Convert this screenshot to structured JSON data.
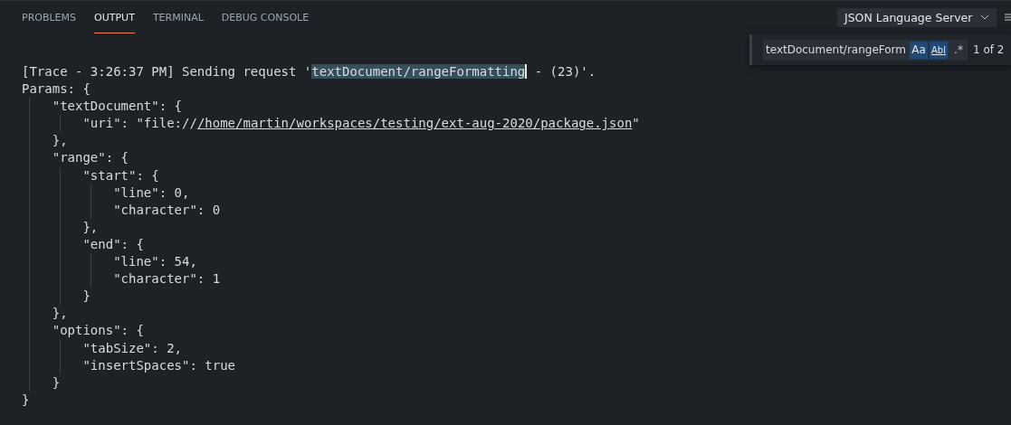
{
  "tabs": [
    {
      "label": "PROBLEMS",
      "selected": false
    },
    {
      "label": "OUTPUT",
      "selected": true
    },
    {
      "label": "TERMINAL",
      "selected": false
    },
    {
      "label": "DEBUG CONSOLE",
      "selected": false
    }
  ],
  "channel_select": {
    "value": "JSON Language Server"
  },
  "find_widget": {
    "value": "textDocument/rangeForm",
    "match_case": {
      "label": "Aa",
      "on": true
    },
    "whole_word": {
      "label": "Abl",
      "on": true
    },
    "regex": {
      "label": ".*",
      "on": false
    },
    "result": "1 of 2"
  },
  "output_lines": [
    {
      "segments": [
        {
          "kind": "plain",
          "text": "[Trace - 3:26:37 PM] Sending request '"
        },
        {
          "kind": "match",
          "text": "textDocument/rangeFormatting",
          "cursor": true
        },
        {
          "kind": "plain",
          "text": " - (23)'."
        }
      ]
    },
    {
      "segments": [
        {
          "kind": "plain",
          "text": "Params: {"
        }
      ]
    },
    {
      "segments": [
        {
          "kind": "plain",
          "text": "    \"textDocument\": {"
        }
      ]
    },
    {
      "segments": [
        {
          "kind": "plain",
          "text": "        \"uri\": \"file://"
        },
        {
          "kind": "link",
          "text": "/home/martin/workspaces/testing/ext-aug-2020/package.json"
        },
        {
          "kind": "plain",
          "text": "\""
        }
      ]
    },
    {
      "segments": [
        {
          "kind": "plain",
          "text": "    },"
        }
      ]
    },
    {
      "segments": [
        {
          "kind": "plain",
          "text": "    \"range\": {"
        }
      ]
    },
    {
      "segments": [
        {
          "kind": "plain",
          "text": "        \"start\": {"
        }
      ]
    },
    {
      "segments": [
        {
          "kind": "plain",
          "text": "            \"line\": 0,"
        }
      ]
    },
    {
      "segments": [
        {
          "kind": "plain",
          "text": "            \"character\": 0"
        }
      ]
    },
    {
      "segments": [
        {
          "kind": "plain",
          "text": "        },"
        }
      ]
    },
    {
      "segments": [
        {
          "kind": "plain",
          "text": "        \"end\": {"
        }
      ]
    },
    {
      "segments": [
        {
          "kind": "plain",
          "text": "            \"line\": 54,"
        }
      ]
    },
    {
      "segments": [
        {
          "kind": "plain",
          "text": "            \"character\": 1"
        }
      ]
    },
    {
      "segments": [
        {
          "kind": "plain",
          "text": "        }"
        }
      ]
    },
    {
      "segments": [
        {
          "kind": "plain",
          "text": "    },"
        }
      ]
    },
    {
      "segments": [
        {
          "kind": "plain",
          "text": "    \"options\": {"
        }
      ]
    },
    {
      "segments": [
        {
          "kind": "plain",
          "text": "        \"tabSize\": 2,"
        }
      ]
    },
    {
      "segments": [
        {
          "kind": "plain",
          "text": "        \"insertSpaces\": true"
        }
      ]
    },
    {
      "segments": [
        {
          "kind": "plain",
          "text": "    }"
        }
      ]
    },
    {
      "segments": [
        {
          "kind": "plain",
          "text": "}"
        }
      ]
    }
  ]
}
